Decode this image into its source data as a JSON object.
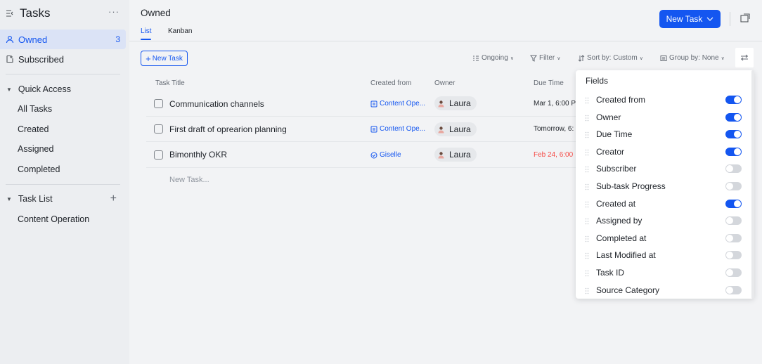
{
  "sidebar": {
    "title": "Tasks",
    "more_label": "···",
    "nav": [
      {
        "label": "Owned",
        "count": "3",
        "icon": "person-icon"
      },
      {
        "label": "Subscribed",
        "icon": "subscribe-icon"
      }
    ],
    "quick_access": {
      "label": "Quick Access",
      "items": [
        {
          "label": "All Tasks"
        },
        {
          "label": "Created"
        },
        {
          "label": "Assigned"
        },
        {
          "label": "Completed"
        }
      ]
    },
    "task_list": {
      "label": "Task List",
      "add_label": "+",
      "items": [
        {
          "label": "Content Operation"
        }
      ]
    }
  },
  "header": {
    "title": "Owned",
    "tabs": [
      {
        "label": "List"
      },
      {
        "label": "Kanban"
      }
    ],
    "new_task_button": "New Task"
  },
  "toolbar": {
    "add_task_label": "New Task",
    "status_label": "Ongoing",
    "filter_label": "Filter",
    "sort_label": "Sort by: Custom",
    "group_label": "Group by: None"
  },
  "table": {
    "columns": {
      "title": "Task Title",
      "created_from": "Created from",
      "owner": "Owner",
      "due": "Due Time"
    },
    "rows": [
      {
        "title": "Communication channels",
        "created_from": "Content Ope...",
        "source_icon": "doc-icon",
        "owner": "Laura",
        "due": "Mar 1, 6:00 P"
      },
      {
        "title": "First draft of oprearion planning",
        "created_from": "Content Ope...",
        "source_icon": "doc-icon",
        "owner": "Laura",
        "due": "Tomorrow, 6:"
      },
      {
        "title": "Bimonthly OKR",
        "created_from": "Giselle",
        "source_icon": "check-circle-icon",
        "owner": "Laura",
        "due": "Feb 24, 6:00"
      }
    ],
    "new_task_placeholder": "New Task..."
  },
  "fields_panel": {
    "title": "Fields",
    "fields": [
      {
        "label": "Created from",
        "on": true
      },
      {
        "label": "Owner",
        "on": true
      },
      {
        "label": "Due Time",
        "on": true
      },
      {
        "label": "Creator",
        "on": true
      },
      {
        "label": "Subscriber",
        "on": false
      },
      {
        "label": "Sub-task Progress",
        "on": false
      },
      {
        "label": "Created at",
        "on": true
      },
      {
        "label": "Assigned by",
        "on": false
      },
      {
        "label": "Completed at",
        "on": false
      },
      {
        "label": "Last Modified at",
        "on": false
      },
      {
        "label": "Task ID",
        "on": false
      },
      {
        "label": "Source Category",
        "on": false
      }
    ]
  },
  "colors": {
    "accent": "#1456f0",
    "overdue": "#f54a45"
  }
}
